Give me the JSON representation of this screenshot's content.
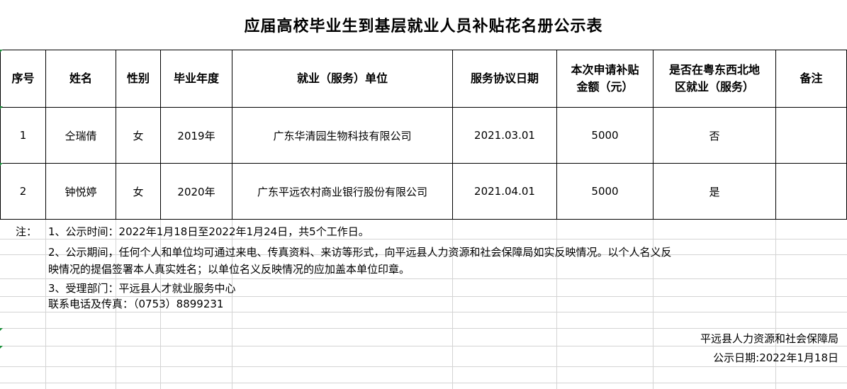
{
  "title": "应届高校毕业生到基层就业人员补贴花名册公示表",
  "table": {
    "headers": {
      "seq": "序号",
      "name": "姓名",
      "gender": "性别",
      "grad_year": "毕业年度",
      "employer": "就业（服务）单位",
      "agreement_date": "服务协议日期",
      "amount_line1": "本次申请补贴",
      "amount_line2": "金额（元）",
      "region_line1": "是否在粤东西北地",
      "region_line2": "区就业（服务）",
      "remarks": "备注"
    },
    "rows": [
      {
        "seq": "1",
        "name": "仝瑞倩",
        "gender": "女",
        "grad_year": "2019年",
        "employer": "广东华清园生物科技有限公司",
        "agreement_date": "2021.03.01",
        "amount": "5000",
        "region": "否",
        "remarks": ""
      },
      {
        "seq": "2",
        "name": "钟悦婷",
        "gender": "女",
        "grad_year": "2020年",
        "employer": "广东平远农村商业银行股份有限公司",
        "agreement_date": "2021.04.01",
        "amount": "5000",
        "region": "是",
        "remarks": ""
      }
    ]
  },
  "notes": {
    "prefix": "注：",
    "line1": "1、公示时间：2022年1月18日至2022年1月24日，共5个工作日。",
    "line2a": "2、公示期间，任何个人和单位均可通过来电、传真资料、来访等形式，向平远县人力资源和社会保障局如实反映情况。以个人名义反",
    "line2b": "映情况的提倡签署本人真实姓名；以单位名义反映情况的应加盖本单位印章。",
    "line3": "3、受理部门：平远县人才就业服务中心",
    "line4": "联系电话及传真：（0753）8899231"
  },
  "footer": {
    "org": "平远县人力资源和社会保障局",
    "date": "公示日期:2022年1月18日"
  }
}
